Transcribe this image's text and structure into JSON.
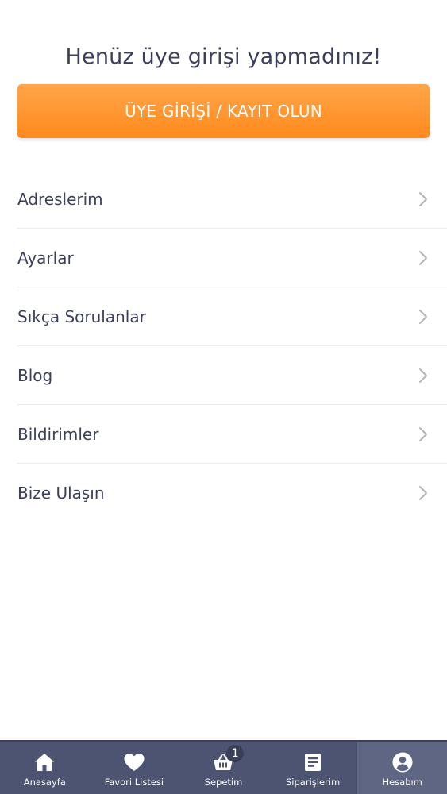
{
  "account": {
    "title": "Henüz üye girişi yapmadınız!",
    "login_button": "ÜYE GİRİŞİ / KAYIT OLUN"
  },
  "menu": {
    "items": [
      {
        "label": "Adreslerim",
        "icon": "chevron-right-icon"
      },
      {
        "label": "Ayarlar",
        "icon": "chevron-right-icon"
      },
      {
        "label": "Sıkça Sorulanlar",
        "icon": "chevron-right-icon"
      },
      {
        "label": "Blog",
        "icon": "chevron-right-icon"
      },
      {
        "label": "Bildirimler",
        "icon": "chevron-right-icon"
      },
      {
        "label": "Bize Ulaşın",
        "icon": "chevron-right-icon"
      }
    ]
  },
  "tabbar": {
    "items": [
      {
        "label": "Anasayfa",
        "icon": "home-icon",
        "active": false
      },
      {
        "label": "Favori Listesi",
        "icon": "heart-icon",
        "active": false
      },
      {
        "label": "Sepetim",
        "icon": "basket-icon",
        "active": false,
        "badge": "1"
      },
      {
        "label": "Siparişlerim",
        "icon": "orders-icon",
        "active": false
      },
      {
        "label": "Hesabım",
        "icon": "account-icon",
        "active": true
      }
    ]
  },
  "colors": {
    "accent_orange": "#ff9933",
    "tabbar_bg": "#4d5472",
    "tabbar_active_bg": "#5f6684",
    "text_primary": "#3b3f5c",
    "chevron": "#b5b5b5"
  }
}
